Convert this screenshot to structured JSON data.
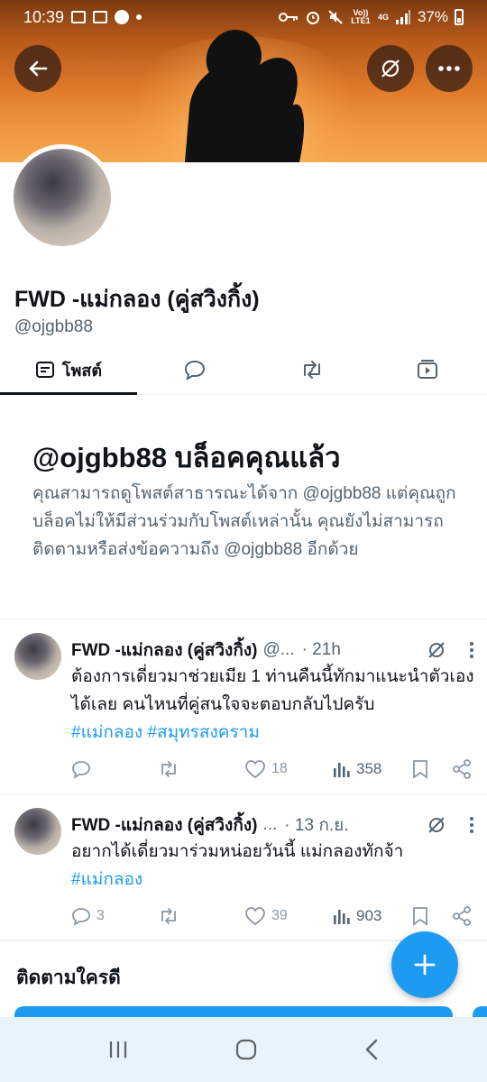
{
  "status_bar": {
    "time": "10:39",
    "network": "Vo)) LTE1",
    "signal_type": "4G",
    "battery": "37%"
  },
  "profile": {
    "display_name": "FWD -แม่กลอง (คู่สวิงกิ้ง)",
    "handle": "@ojgbb88"
  },
  "tabs": {
    "posts_label": "โพสต์"
  },
  "blocked": {
    "title": "@ojgbb88 บล็อคคุณแล้ว",
    "description": "คุณสามารถดูโพสต์สาธารณะได้จาก @ojgbb88 แต่คุณถูกบล็อคไม่ให้มีส่วนร่วมกับโพสต์เหล่านั้น คุณยังไม่สามารถติดตามหรือส่งข้อความถึง @ojgbb88 อีกด้วย"
  },
  "tweets": [
    {
      "name": "FWD -แม่กลอง (คู่สวิงกิ้ง)",
      "handle_truncated": "@...",
      "time": "· 21h",
      "text": "ต้องการเดี่ยวมาช่วยเมีย 1 ท่านคืนนี้ทักมาแนะนำตัวเองได้เลย คนไหนที่คู่สนใจจะตอบกลับไปครับ",
      "hashtags": "#แม่กลอง #สมุทรสงคราม",
      "replies": "",
      "likes": "18",
      "views": "358"
    },
    {
      "name": "FWD -แม่กลอง (คู่สวิงกิ้ง)",
      "handle_truncated": "...",
      "time": "· 13 ก.ย.",
      "text": "อยากได้เดี่ยวมาร่วมหน่อยวันนี้ แม่กลองทักจ้า",
      "hashtags": "#แม่กลอง",
      "replies": "3",
      "likes": "39",
      "views": "903"
    }
  ],
  "who_to_follow": {
    "title": "ติดตามใครดี"
  },
  "colors": {
    "accent": "#1d9bf0",
    "text": "#0f1419",
    "muted": "#536471"
  }
}
